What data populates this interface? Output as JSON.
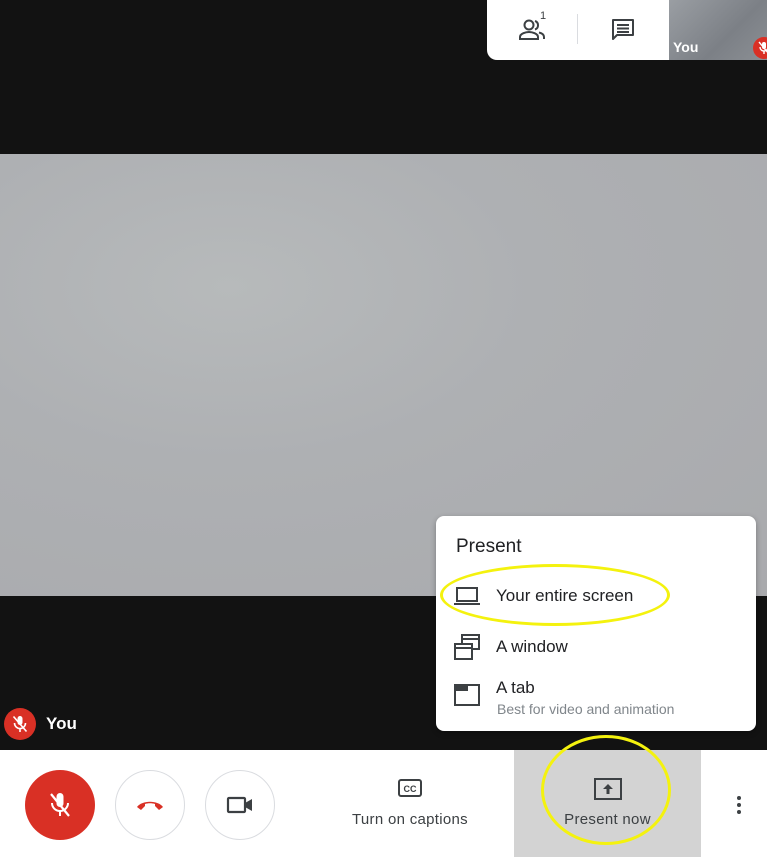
{
  "self_view": {
    "name": "You"
  },
  "participant_label": {
    "name": "You"
  },
  "top_panel": {
    "people_count": "1"
  },
  "present_menu": {
    "title": "Present",
    "items": [
      {
        "label": "Your entire screen",
        "icon": "laptop-icon"
      },
      {
        "label": "A window",
        "icon": "window-icon"
      },
      {
        "label": "A tab",
        "subtitle": "Best for video and animation",
        "icon": "tab-icon"
      }
    ]
  },
  "bottom_bar": {
    "captions_label": "Turn on captions",
    "present_label": "Present now"
  },
  "colors": {
    "mic_off_red": "#d93025",
    "highlight_yellow": "#f4f20e",
    "present_active_bg": "#d3d3d3"
  }
}
